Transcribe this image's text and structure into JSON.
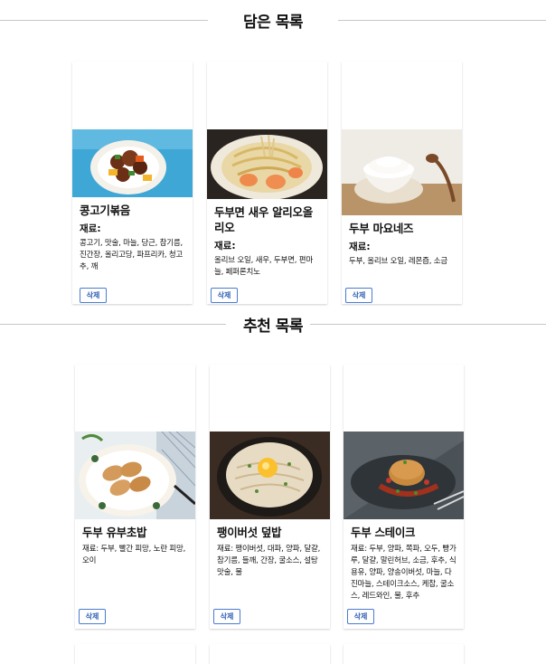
{
  "saved_section": {
    "title": "담은 목록",
    "cards": [
      {
        "name": "콩고기볶음",
        "ingredients_label": "재료:",
        "ingredients": "콩고기, 맛술, 마늘, 당근, 참기름, 진간장, 올리고당, 파프리카, 청고추, 깨",
        "delete_label": "삭제"
      },
      {
        "name": "두부면 새우 알리오올리오",
        "ingredients_label": "재료:",
        "ingredients": "올리브 오일, 새우, 두부면, 편마늘, 페퍼론치노",
        "delete_label": "삭제"
      },
      {
        "name": "두부 마요네즈",
        "ingredients_label": "재료:",
        "ingredients": "두부, 올리브 오일, 레몬즙, 소금",
        "delete_label": "삭제"
      }
    ]
  },
  "recommended_section": {
    "title": "추천 목록",
    "cards": [
      {
        "name": "두부 유부초밥",
        "ingredients_label": "재료:",
        "ingredients": "두부, 빨간 피망, 노란 피망, 오이",
        "delete_label": "삭제"
      },
      {
        "name": "팽이버섯 덮밥",
        "ingredients_label": "재료:",
        "ingredients": "팽이버섯, 대파, 양파, 달걀, 참기름, 들깨, 간장, 굴소스, 설탕 맛술, 물",
        "delete_label": "삭제"
      },
      {
        "name": "두부 스테이크",
        "ingredients_label": "재료:",
        "ingredients": "두부, 양파, 쪽파, 오두, 빵가루, 달걀, 말린허브, 소금, 후추, 식용유, 양파, 양송이버섯, 마늘, 다진마늘, 스테이크소스, 케찹, 굴소스, 레드와인, 물, 후추",
        "delete_label": "삭제"
      }
    ]
  },
  "icons": {
    "photo_1": "braised-soy-meat-photo",
    "photo_2": "shrimp-aglio-olio-photo",
    "photo_3": "tofu-mayo-photo",
    "photo_4": "tofu-inari-photo",
    "photo_5": "enoki-rice-bowl-photo",
    "photo_6": "tofu-steak-photo"
  }
}
